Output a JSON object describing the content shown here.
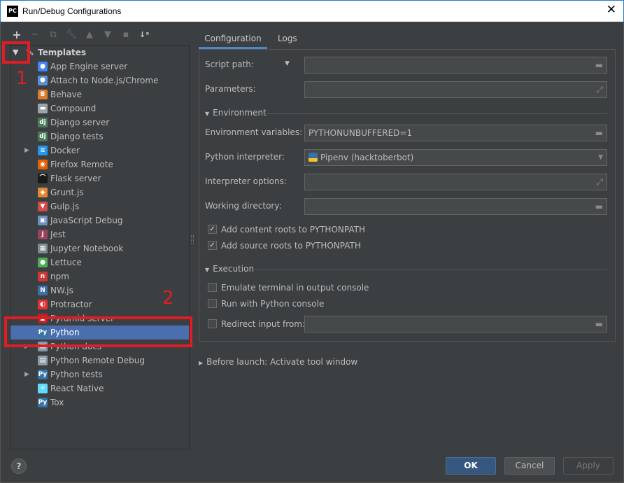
{
  "window": {
    "title": "Run/Debug Configurations",
    "app_icon": "PC"
  },
  "toolbar": {
    "buttons": [
      "+",
      "−",
      "⧉",
      "🔧",
      "▲",
      "▼",
      "📁",
      "↓a"
    ]
  },
  "tree": {
    "root_label": "Templates",
    "items": [
      {
        "label": "App Engine server",
        "icon": "app-engine-icon",
        "color": "#4285f4",
        "glyph": "●",
        "expandable": false
      },
      {
        "label": "Attach to Node.js/Chrome",
        "icon": "nodejs-icon",
        "color": "#5b8fd1",
        "glyph": "⬢",
        "expandable": false
      },
      {
        "label": "Behave",
        "icon": "behave-icon",
        "color": "#e07b26",
        "glyph": "B",
        "expandable": false
      },
      {
        "label": "Compound",
        "icon": "compound-icon",
        "color": "#9aa3a8",
        "glyph": "▬",
        "expandable": false
      },
      {
        "label": "Django server",
        "icon": "django-icon",
        "color": "#4a7a5b",
        "glyph": "dj",
        "expandable": false
      },
      {
        "label": "Django tests",
        "icon": "django-tests-icon",
        "color": "#4a7a5b",
        "glyph": "dj",
        "expandable": false
      },
      {
        "label": "Docker",
        "icon": "docker-icon",
        "color": "#2496ed",
        "glyph": "≋",
        "expandable": true
      },
      {
        "label": "Firefox Remote",
        "icon": "firefox-icon",
        "color": "#e66000",
        "glyph": "◉",
        "expandable": false
      },
      {
        "label": "Flask server",
        "icon": "flask-icon",
        "color": "#1a1a1a",
        "glyph": "⌒",
        "expandable": false
      },
      {
        "label": "Grunt.js",
        "icon": "grunt-icon",
        "color": "#e48632",
        "glyph": "◆",
        "expandable": false
      },
      {
        "label": "Gulp.js",
        "icon": "gulp-icon",
        "color": "#d34a47",
        "glyph": "▼",
        "expandable": false
      },
      {
        "label": "JavaScript Debug",
        "icon": "js-debug-icon",
        "color": "#6b8ec4",
        "glyph": "▣",
        "expandable": false
      },
      {
        "label": "Jest",
        "icon": "jest-icon",
        "color": "#99425b",
        "glyph": "J",
        "expandable": false
      },
      {
        "label": "Jupyter Notebook",
        "icon": "jupyter-icon",
        "color": "#7f8c8d",
        "glyph": "▦",
        "expandable": false
      },
      {
        "label": "Lettuce",
        "icon": "lettuce-icon",
        "color": "#4caf50",
        "glyph": "●",
        "expandable": false
      },
      {
        "label": "npm",
        "icon": "npm-icon",
        "color": "#cb3837",
        "glyph": "n",
        "expandable": false
      },
      {
        "label": "NW.js",
        "icon": "nwjs-icon",
        "color": "#3d6fa6",
        "glyph": "N",
        "expandable": false
      },
      {
        "label": "Protractor",
        "icon": "protractor-icon",
        "color": "#e23237",
        "glyph": "◐",
        "expandable": false
      },
      {
        "label": "Pyramid server",
        "icon": "pyramid-icon",
        "color": "#b22",
        "glyph": "▲",
        "expandable": false
      },
      {
        "label": "Python",
        "icon": "python-icon",
        "color": "#3572a5",
        "glyph": "Py",
        "expandable": false,
        "selected": true
      },
      {
        "label": "Python docs",
        "icon": "python-docs-icon",
        "color": "#8a9aa8",
        "glyph": "▤",
        "expandable": true
      },
      {
        "label": "Python Remote Debug",
        "icon": "python-remote-icon",
        "color": "#8a9aa8",
        "glyph": "▤",
        "expandable": false
      },
      {
        "label": "Python tests",
        "icon": "python-tests-icon",
        "color": "#3572a5",
        "glyph": "Py",
        "expandable": true
      },
      {
        "label": "React Native",
        "icon": "react-native-icon",
        "color": "#61dafb",
        "glyph": "⚛",
        "expandable": false
      },
      {
        "label": "Tox",
        "icon": "tox-icon",
        "color": "#3572a5",
        "glyph": "Py",
        "expandable": false
      }
    ]
  },
  "annotations": {
    "label_1": "1",
    "label_2": "2",
    "color": "#e01d24"
  },
  "tabs": [
    "Configuration",
    "Logs"
  ],
  "config": {
    "script_path_label": "Script path:",
    "script_path_value": "",
    "parameters_label": "Parameters:",
    "parameters_value": "",
    "environment_section": "Environment",
    "env_vars_label": "Environment variables:",
    "env_vars_value": "PYTHONUNBUFFERED=1",
    "interpreter_label": "Python interpreter:",
    "interpreter_value": "Pipenv (hacktoberbot)",
    "interp_options_label": "Interpreter options:",
    "interp_options_value": "",
    "working_dir_label": "Working directory:",
    "working_dir_value": "",
    "add_content_roots": "Add content roots to PYTHONPATH",
    "add_content_roots_checked": true,
    "add_source_roots": "Add source roots to PYTHONPATH",
    "add_source_roots_checked": true,
    "execution_section": "Execution",
    "emulate_terminal": "Emulate terminal in output console",
    "run_with_console": "Run with Python console",
    "redirect_input": "Redirect input from:",
    "redirect_input_value": ""
  },
  "before_launch": "Before launch: Activate tool window",
  "footer": {
    "help": "?",
    "ok": "OK",
    "cancel": "Cancel",
    "apply": "Apply"
  },
  "colors": {
    "background": "#3c3f41",
    "selection": "#4b6eaf",
    "accent": "#4a88c7",
    "primary_button": "#365880"
  }
}
